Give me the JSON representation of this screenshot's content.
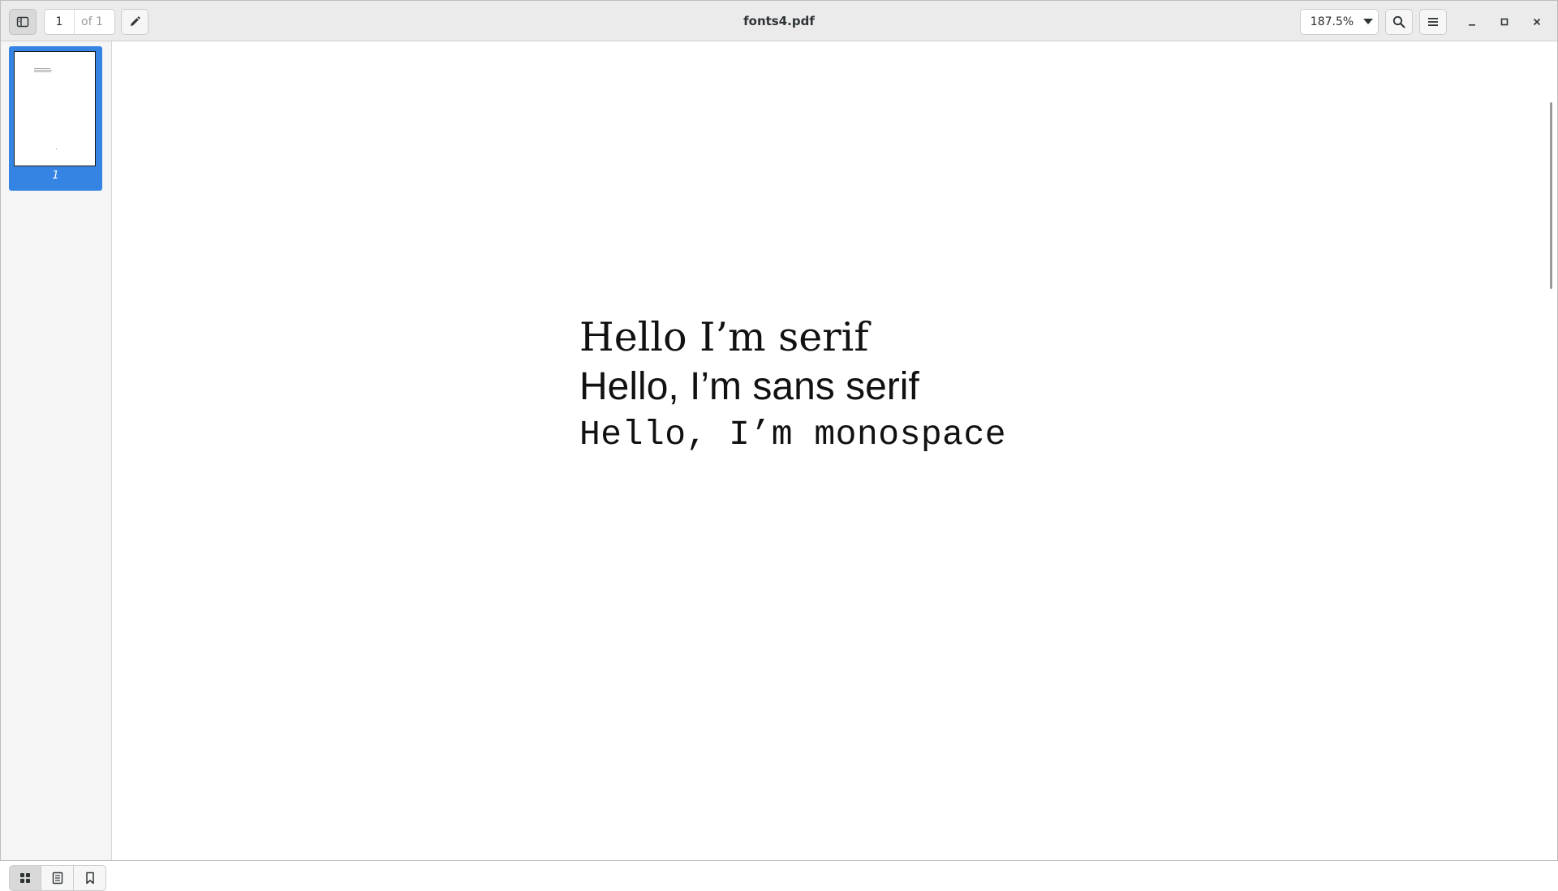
{
  "window": {
    "title": "fonts4.pdf"
  },
  "header": {
    "sidebar_toggle_icon": "sidebar-toggle-icon",
    "page_current": "1",
    "page_total": "of 1",
    "annotate_icon": "pencil-icon",
    "zoom_value": "187.5%",
    "zoom_icon": "chevron-down-icon",
    "search_icon": "search-icon",
    "menu_icon": "hamburger-menu-icon",
    "minimize_icon": "minimize-icon",
    "maximize_icon": "maximize-icon",
    "close_icon": "close-icon"
  },
  "sidebar": {
    "thumbnails": [
      {
        "label": "1",
        "selected": true
      }
    ],
    "tabs": [
      {
        "icon": "thumbnails-grid-icon",
        "active": true
      },
      {
        "icon": "document-outline-icon",
        "active": false
      },
      {
        "icon": "bookmark-icon",
        "active": false
      }
    ]
  },
  "document": {
    "lines": [
      "Hello I’m serif",
      "Hello, I’m sans serif",
      "Hello, I’m monospace"
    ]
  },
  "colors": {
    "accent": "#3584e4",
    "headerbar": "#ebebeb",
    "sidebar": "#f5f5f5"
  }
}
